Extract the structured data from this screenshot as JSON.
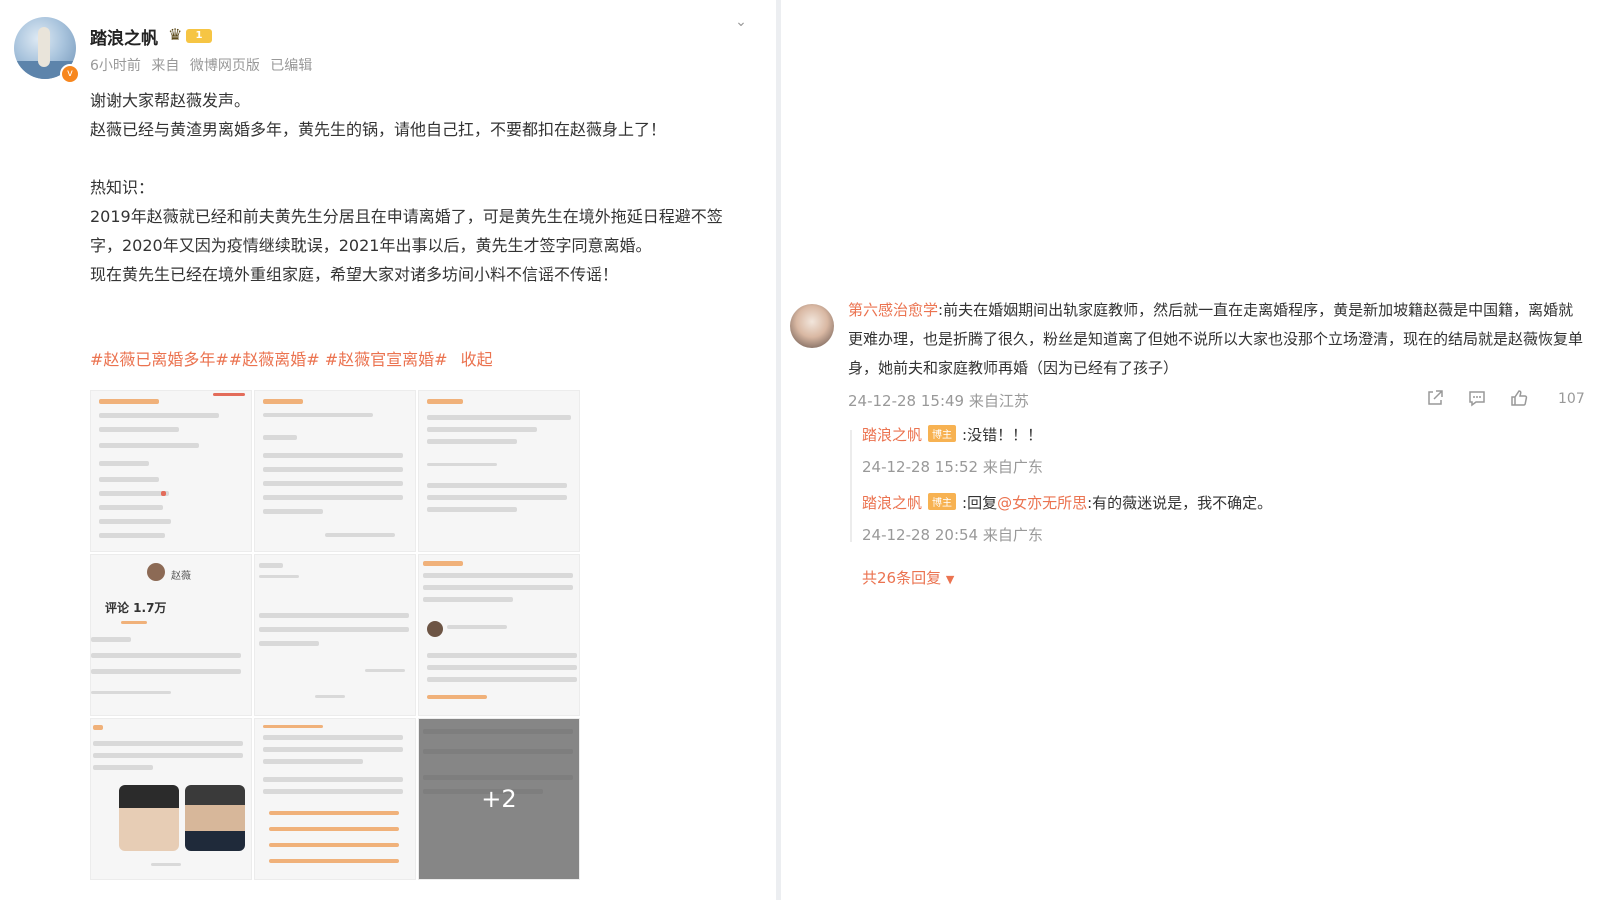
{
  "post": {
    "author": "踏浪之帆",
    "level": "1",
    "time": "6小时前",
    "source_prefix": "来自",
    "source": "微博网页版",
    "edited": "已编辑",
    "lines": [
      "谢谢大家帮赵薇发声。",
      "赵薇已经与黄渣男离婚多年，黄先生的锅，请他自己扛，不要都扣在赵薇身上了！",
      "",
      "热知识：",
      "2019年赵薇就已经和前夫黄先生分居且在申请离婚了，可是黄先生在境外拖延日程避不签字，2020年又因为疫情继续耽误，2021年出事以后，黄先生才签字同意离婚。",
      "现在黄先生已经在境外重组家庭，希望大家对诸多坊间小料不信谣不传谣！"
    ],
    "tags": [
      "#赵薇已离婚多年#",
      "#赵薇离婚#",
      "#赵薇官宣离婚#"
    ],
    "collapse": "收起",
    "images": {
      "img4_name": "赵薇",
      "img4_comments": "评论 1.7万",
      "more_count": "+2"
    }
  },
  "comment": {
    "author": "第六感治愈学",
    "text": ":前夫在婚姻期间出轨家庭教师，然后就一直在走离婚程序，黄是新加坡籍赵薇是中国籍，离婚就更难办理，也是折腾了很久，粉丝是知道离了但她不说所以大家也没那个立场澄清，现在的结局就是赵薇恢复单身，她前夫和家庭教师再婚（因为已经有了孩子）",
    "time": "24-12-28 15:49",
    "location": "来自江苏",
    "likes": "107",
    "replies": [
      {
        "author": "踏浪之帆",
        "badge": "博主",
        "prefix": "",
        "mention": "",
        "text": ":没错！！！",
        "time": "24-12-28 15:52",
        "location": "来自广东"
      },
      {
        "author": "踏浪之帆",
        "badge": "博主",
        "prefix": ":回复",
        "mention": "@女亦无所思",
        "text": ":有的薇迷说是，我不确定。",
        "time": "24-12-28 20:54",
        "location": "来自广东"
      }
    ],
    "total_replies": "共26条回复"
  }
}
